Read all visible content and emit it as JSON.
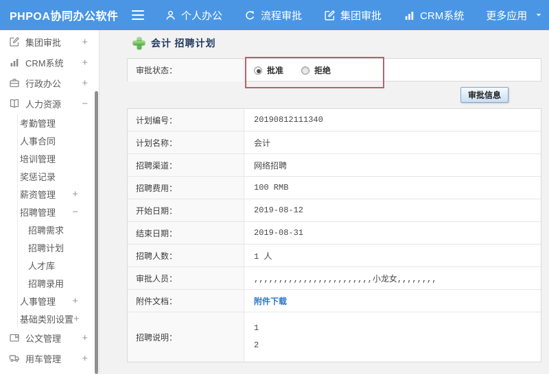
{
  "topbar": {
    "logo": "PHPOA协同办公软件",
    "hamburger_icon": "hamburger-icon",
    "nav": [
      {
        "icon": "user-icon",
        "label": "个人办公"
      },
      {
        "icon": "process-icon",
        "label": "流程审批"
      },
      {
        "icon": "edit-square-icon",
        "label": "集团审批"
      },
      {
        "icon": "bar-chart-icon",
        "label": "CRM系统"
      },
      {
        "icon": null,
        "label": "更多应用",
        "caret": true
      }
    ]
  },
  "sidebar": {
    "items": [
      {
        "label": "集团审批",
        "icon": "edit-square-icon",
        "expander": "+",
        "level": 0
      },
      {
        "label": "CRM系统",
        "icon": "bar-chart-icon",
        "expander": "+",
        "level": 0
      },
      {
        "label": "行政办公",
        "icon": "briefcase-icon",
        "expander": "+",
        "level": 0
      },
      {
        "label": "人力资源",
        "icon": "book-icon",
        "expander": "−",
        "level": 0
      },
      {
        "label": "考勤管理",
        "level": 1
      },
      {
        "label": "人事合同",
        "level": 1
      },
      {
        "label": "培训管理",
        "level": 1
      },
      {
        "label": "奖惩记录",
        "level": 1
      },
      {
        "label": "薪资管理",
        "expander": "+",
        "level": 1
      },
      {
        "label": "招聘管理",
        "expander": "−",
        "level": 1
      },
      {
        "label": "招聘需求",
        "level": 2
      },
      {
        "label": "招聘计划",
        "level": 2
      },
      {
        "label": "人才库",
        "level": 2
      },
      {
        "label": "招聘录用",
        "level": 2
      },
      {
        "label": "人事管理",
        "expander": "+",
        "level": 1
      },
      {
        "label": "基础类别设置",
        "expander": "+",
        "level": 1
      },
      {
        "label": "公文管理",
        "icon": "document-icon",
        "expander": "+",
        "level": 0
      },
      {
        "label": "用车管理",
        "icon": "car-icon",
        "expander": "+",
        "level": 0
      }
    ]
  },
  "main": {
    "title": "会计 招聘计划",
    "title_icon": "plus-icon",
    "approval": {
      "label": "审批状态：",
      "options": [
        {
          "label": "批准",
          "selected": true
        },
        {
          "label": "拒绝",
          "selected": false
        }
      ]
    },
    "approval_info_button": "审批信息",
    "fields": [
      {
        "label": "计划编号：",
        "value": "20190812111340"
      },
      {
        "label": "计划名称：",
        "value": "会计"
      },
      {
        "label": "招聘渠道：",
        "value": "网络招聘"
      },
      {
        "label": "招聘费用：",
        "value": "100 RMB"
      },
      {
        "label": "开始日期：",
        "value": "2019-08-12"
      },
      {
        "label": "结束日期：",
        "value": "2019-08-31"
      },
      {
        "label": "招聘人数：",
        "value": "1 人"
      },
      {
        "label": "审批人员：",
        "value": ",,,,,,,,,,,,,,,,,,,,,,,,小龙女,,,,,,,,"
      },
      {
        "label": "附件文档：",
        "value": "附件下载",
        "type": "link"
      },
      {
        "label": "招聘说明：",
        "value": "1\n2",
        "type": "multiline"
      }
    ]
  },
  "colors": {
    "accent": "#4a96e4",
    "page_bg": "#f2f2f2",
    "red_annotation": "#b9616b",
    "link": "#2d77cc",
    "plus_green": "#4fae46",
    "button_border": "#86a5c7",
    "title_text": "#233a60"
  }
}
